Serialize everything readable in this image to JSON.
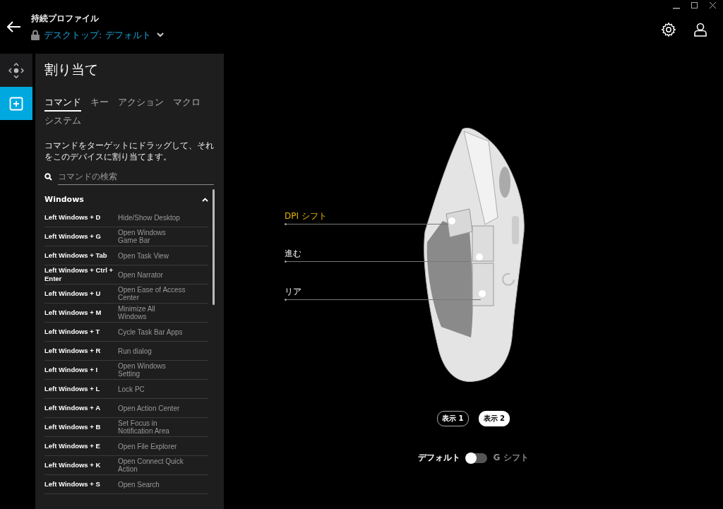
{
  "header": {
    "subtitle": "持続プロファイル",
    "profile": "デスクトップ: デフォルト"
  },
  "rail": [
    {
      "kind": "move",
      "selected": false
    },
    {
      "kind": "assign",
      "selected": true
    }
  ],
  "panel": {
    "title": "割り当て",
    "tabs": [
      {
        "label": "コマンド",
        "selected": true
      },
      {
        "label": "キー",
        "selected": false
      },
      {
        "label": "アクション",
        "selected": false
      },
      {
        "label": "マクロ",
        "selected": false
      },
      {
        "label": "システム",
        "selected": false
      }
    ],
    "description": "コマンドをターゲットにドラッグして、それをこのデバイスに割り当てます。",
    "search": {
      "placeholder": "コマンドの検索"
    },
    "section": {
      "title": "Windows",
      "expanded": true,
      "rows": [
        {
          "key": "Left Windows + D",
          "action": "Hide/Show Desktop"
        },
        {
          "key": "Left Windows + G",
          "action": "Open Windows Game Bar"
        },
        {
          "key": "Left Windows + Tab",
          "action": "Open Task View"
        },
        {
          "key": "Left Windows + Ctrl + Enter",
          "action": "Open Narrator"
        },
        {
          "key": "Left Windows + U",
          "action": "Open Ease of Access Center"
        },
        {
          "key": "Left Windows + M",
          "action": "Minimize All Windows"
        },
        {
          "key": "Left Windows + T",
          "action": "Cycle Task Bar Apps"
        },
        {
          "key": "Left Windows + R",
          "action": "Run dialog"
        },
        {
          "key": "Left Windows + I",
          "action": "Open Windows Setting"
        },
        {
          "key": "Left Windows + L",
          "action": "Lock PC"
        },
        {
          "key": "Left Windows + A",
          "action": "Open Action Center"
        },
        {
          "key": "Left Windows + B",
          "action": "Set Focus in Notification Area"
        },
        {
          "key": "Left Windows + E",
          "action": "Open File Explorer"
        },
        {
          "key": "Left Windows + K",
          "action": "Open Connect Quick Action"
        },
        {
          "key": "Left Windows + S",
          "action": "Open Search"
        }
      ]
    }
  },
  "callouts": [
    {
      "label": "DPI シフト",
      "selected": true
    },
    {
      "label": "進む",
      "selected": false
    },
    {
      "label": "リア",
      "selected": false
    }
  ],
  "views": [
    {
      "label": "表示 1",
      "selected": false
    },
    {
      "label": "表示 2",
      "selected": true
    }
  ],
  "shift_toggle": {
    "left_label": "デフォルト",
    "right_label": "G シフト",
    "on": false
  }
}
